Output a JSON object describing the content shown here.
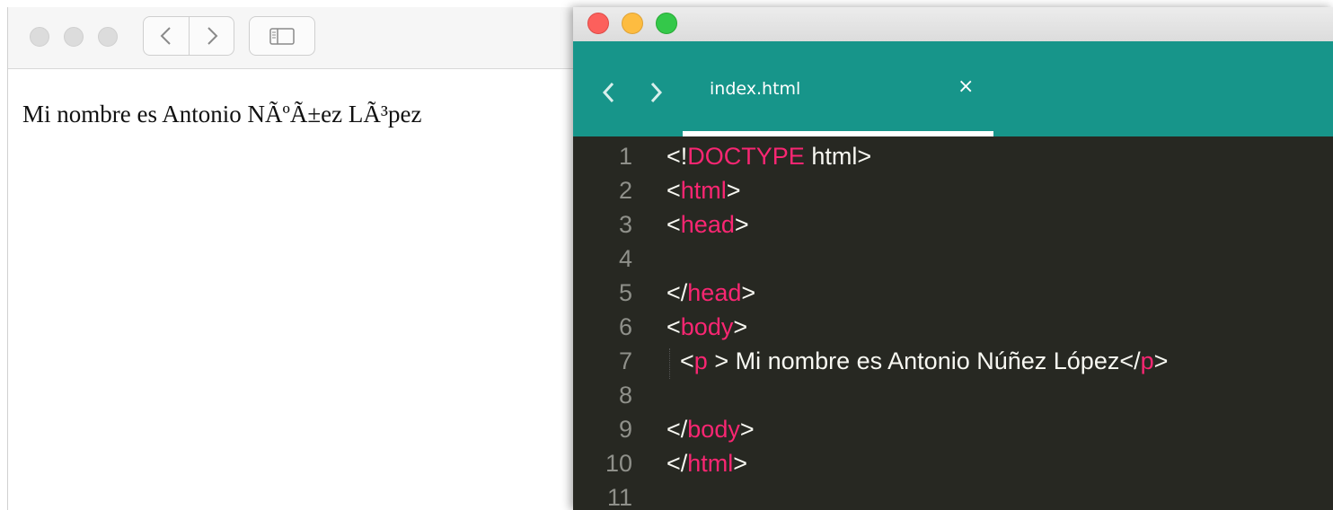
{
  "browser": {
    "page_text": "Mi nombre es Antonio NÃºÃ±ez LÃ³pez"
  },
  "editor": {
    "tab": {
      "filename": "index.html",
      "close_symbol": "×"
    },
    "lines": [
      {
        "number": "1",
        "tokens": [
          {
            "t": "<!",
            "c": "punct"
          },
          {
            "t": "DOCTYPE",
            "c": "tag"
          },
          {
            "t": " html>",
            "c": "punct"
          }
        ]
      },
      {
        "number": "2",
        "tokens": [
          {
            "t": "<",
            "c": "punct"
          },
          {
            "t": "html",
            "c": "tag"
          },
          {
            "t": ">",
            "c": "punct"
          }
        ]
      },
      {
        "number": "3",
        "tokens": [
          {
            "t": "<",
            "c": "punct"
          },
          {
            "t": "head",
            "c": "tag"
          },
          {
            "t": ">",
            "c": "punct"
          }
        ]
      },
      {
        "number": "4",
        "tokens": []
      },
      {
        "number": "5",
        "tokens": [
          {
            "t": "</",
            "c": "punct"
          },
          {
            "t": "head",
            "c": "tag"
          },
          {
            "t": ">",
            "c": "punct"
          }
        ]
      },
      {
        "number": "6",
        "tokens": [
          {
            "t": "<",
            "c": "punct"
          },
          {
            "t": "body",
            "c": "tag"
          },
          {
            "t": ">",
            "c": "punct"
          }
        ]
      },
      {
        "number": "7",
        "tokens": [
          {
            "t": "  <",
            "c": "punct"
          },
          {
            "t": "p",
            "c": "tag"
          },
          {
            "t": " > Mi nombre es Antonio Núñez López</",
            "c": "punct"
          },
          {
            "t": "p",
            "c": "tag"
          },
          {
            "t": ">",
            "c": "punct"
          }
        ]
      },
      {
        "number": "8",
        "tokens": []
      },
      {
        "number": "9",
        "tokens": [
          {
            "t": "</",
            "c": "punct"
          },
          {
            "t": "body",
            "c": "tag"
          },
          {
            "t": ">",
            "c": "punct"
          }
        ]
      },
      {
        "number": "10",
        "tokens": [
          {
            "t": "</",
            "c": "punct"
          },
          {
            "t": "html",
            "c": "tag"
          },
          {
            "t": ">",
            "c": "punct"
          }
        ]
      },
      {
        "number": "11",
        "tokens": []
      }
    ]
  },
  "colors": {
    "editor_header": "#17958a",
    "editor_background": "#272822",
    "tag": "#f92672",
    "text": "#f8f8f2",
    "line_number": "#8f908a",
    "traffic_close": "#fc605c",
    "traffic_minimize": "#fdbc40",
    "traffic_zoom": "#34c84a"
  },
  "icons": {
    "browser": [
      "window-dot-icon",
      "window-dot-icon",
      "window-dot-icon",
      "chevron-left-icon",
      "chevron-right-icon",
      "sidebar-icon"
    ],
    "editor": [
      "close-dot-icon",
      "minimize-dot-icon",
      "zoom-dot-icon",
      "chevron-left-icon",
      "chevron-right-icon",
      "close-icon"
    ]
  }
}
